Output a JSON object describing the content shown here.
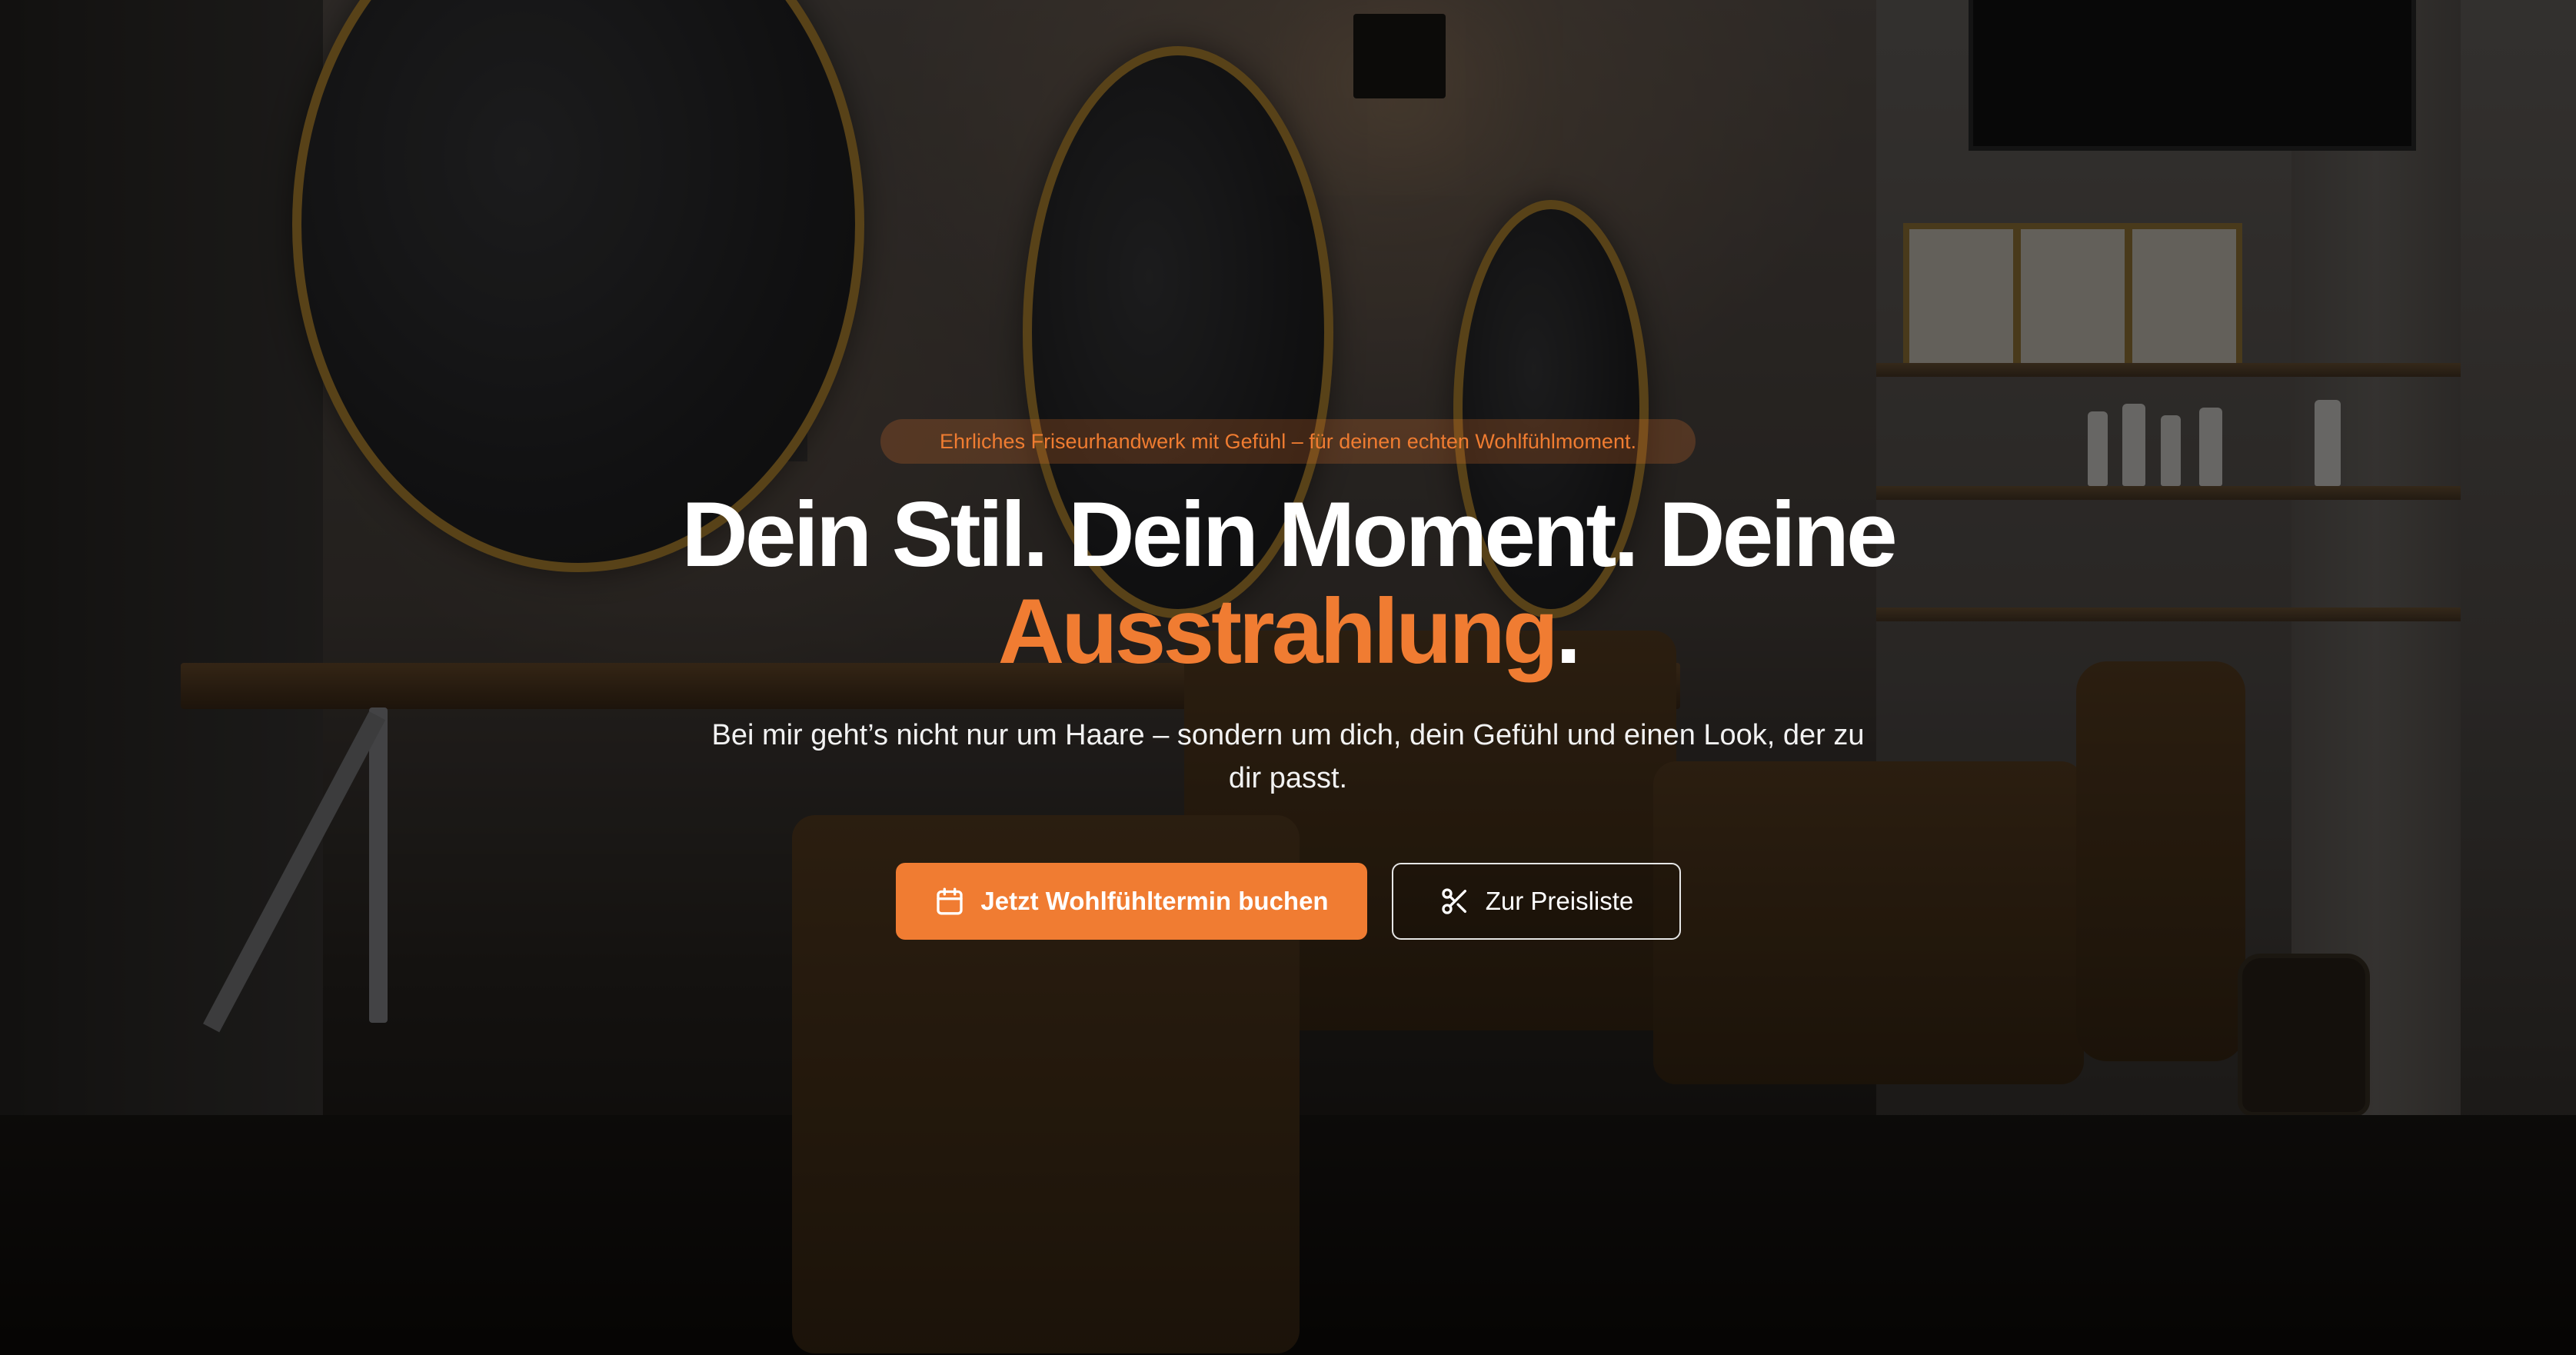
{
  "hero": {
    "tagline": "Ehrliches Friseurhandwerk mit Gefühl – für deinen echten Wohlfühlmoment.",
    "headline_main": "Dein Stil. Dein Moment. Deine ",
    "headline_accent": "Ausstrahlung",
    "headline_end": ".",
    "subtitle": "Bei mir geht’s nicht nur um Haare – sondern um dich, dein Gefühl und einen Look, der zu dir passt.",
    "primary_button": {
      "label": "Jetzt Wohlfühltermin buchen",
      "icon": "calendar-icon"
    },
    "secondary_button": {
      "label": "Zur Preisliste",
      "icon": "scissors-icon"
    }
  },
  "colors": {
    "accent": "#f07c32",
    "text": "#ffffff",
    "overlay": "rgba(0,0,0,0.52)"
  }
}
